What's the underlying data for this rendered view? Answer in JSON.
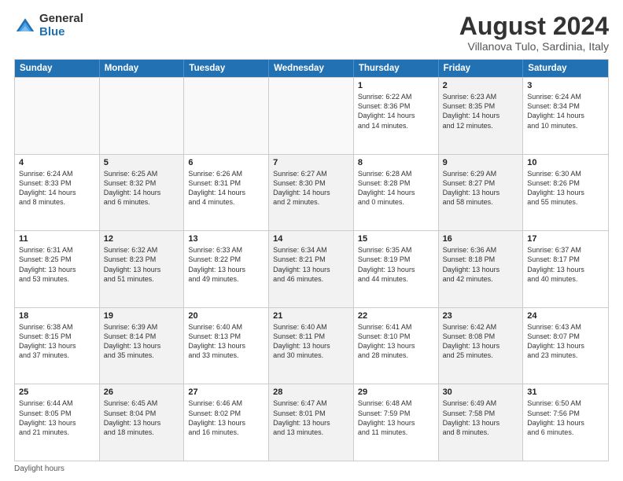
{
  "header": {
    "logo_general": "General",
    "logo_blue": "Blue",
    "month_year": "August 2024",
    "location": "Villanova Tulo, Sardinia, Italy"
  },
  "days_of_week": [
    "Sunday",
    "Monday",
    "Tuesday",
    "Wednesday",
    "Thursday",
    "Friday",
    "Saturday"
  ],
  "footer_note": "Daylight hours",
  "weeks": [
    [
      {
        "day": "",
        "detail": "",
        "shaded": true
      },
      {
        "day": "",
        "detail": "",
        "shaded": true
      },
      {
        "day": "",
        "detail": "",
        "shaded": true
      },
      {
        "day": "",
        "detail": "",
        "shaded": true
      },
      {
        "day": "1",
        "detail": "Sunrise: 6:22 AM\nSunset: 8:36 PM\nDaylight: 14 hours\nand 14 minutes.",
        "shaded": false
      },
      {
        "day": "2",
        "detail": "Sunrise: 6:23 AM\nSunset: 8:35 PM\nDaylight: 14 hours\nand 12 minutes.",
        "shaded": true
      },
      {
        "day": "3",
        "detail": "Sunrise: 6:24 AM\nSunset: 8:34 PM\nDaylight: 14 hours\nand 10 minutes.",
        "shaded": false
      }
    ],
    [
      {
        "day": "4",
        "detail": "Sunrise: 6:24 AM\nSunset: 8:33 PM\nDaylight: 14 hours\nand 8 minutes.",
        "shaded": false
      },
      {
        "day": "5",
        "detail": "Sunrise: 6:25 AM\nSunset: 8:32 PM\nDaylight: 14 hours\nand 6 minutes.",
        "shaded": true
      },
      {
        "day": "6",
        "detail": "Sunrise: 6:26 AM\nSunset: 8:31 PM\nDaylight: 14 hours\nand 4 minutes.",
        "shaded": false
      },
      {
        "day": "7",
        "detail": "Sunrise: 6:27 AM\nSunset: 8:30 PM\nDaylight: 14 hours\nand 2 minutes.",
        "shaded": true
      },
      {
        "day": "8",
        "detail": "Sunrise: 6:28 AM\nSunset: 8:28 PM\nDaylight: 14 hours\nand 0 minutes.",
        "shaded": false
      },
      {
        "day": "9",
        "detail": "Sunrise: 6:29 AM\nSunset: 8:27 PM\nDaylight: 13 hours\nand 58 minutes.",
        "shaded": true
      },
      {
        "day": "10",
        "detail": "Sunrise: 6:30 AM\nSunset: 8:26 PM\nDaylight: 13 hours\nand 55 minutes.",
        "shaded": false
      }
    ],
    [
      {
        "day": "11",
        "detail": "Sunrise: 6:31 AM\nSunset: 8:25 PM\nDaylight: 13 hours\nand 53 minutes.",
        "shaded": false
      },
      {
        "day": "12",
        "detail": "Sunrise: 6:32 AM\nSunset: 8:23 PM\nDaylight: 13 hours\nand 51 minutes.",
        "shaded": true
      },
      {
        "day": "13",
        "detail": "Sunrise: 6:33 AM\nSunset: 8:22 PM\nDaylight: 13 hours\nand 49 minutes.",
        "shaded": false
      },
      {
        "day": "14",
        "detail": "Sunrise: 6:34 AM\nSunset: 8:21 PM\nDaylight: 13 hours\nand 46 minutes.",
        "shaded": true
      },
      {
        "day": "15",
        "detail": "Sunrise: 6:35 AM\nSunset: 8:19 PM\nDaylight: 13 hours\nand 44 minutes.",
        "shaded": false
      },
      {
        "day": "16",
        "detail": "Sunrise: 6:36 AM\nSunset: 8:18 PM\nDaylight: 13 hours\nand 42 minutes.",
        "shaded": true
      },
      {
        "day": "17",
        "detail": "Sunrise: 6:37 AM\nSunset: 8:17 PM\nDaylight: 13 hours\nand 40 minutes.",
        "shaded": false
      }
    ],
    [
      {
        "day": "18",
        "detail": "Sunrise: 6:38 AM\nSunset: 8:15 PM\nDaylight: 13 hours\nand 37 minutes.",
        "shaded": false
      },
      {
        "day": "19",
        "detail": "Sunrise: 6:39 AM\nSunset: 8:14 PM\nDaylight: 13 hours\nand 35 minutes.",
        "shaded": true
      },
      {
        "day": "20",
        "detail": "Sunrise: 6:40 AM\nSunset: 8:13 PM\nDaylight: 13 hours\nand 33 minutes.",
        "shaded": false
      },
      {
        "day": "21",
        "detail": "Sunrise: 6:40 AM\nSunset: 8:11 PM\nDaylight: 13 hours\nand 30 minutes.",
        "shaded": true
      },
      {
        "day": "22",
        "detail": "Sunrise: 6:41 AM\nSunset: 8:10 PM\nDaylight: 13 hours\nand 28 minutes.",
        "shaded": false
      },
      {
        "day": "23",
        "detail": "Sunrise: 6:42 AM\nSunset: 8:08 PM\nDaylight: 13 hours\nand 25 minutes.",
        "shaded": true
      },
      {
        "day": "24",
        "detail": "Sunrise: 6:43 AM\nSunset: 8:07 PM\nDaylight: 13 hours\nand 23 minutes.",
        "shaded": false
      }
    ],
    [
      {
        "day": "25",
        "detail": "Sunrise: 6:44 AM\nSunset: 8:05 PM\nDaylight: 13 hours\nand 21 minutes.",
        "shaded": false
      },
      {
        "day": "26",
        "detail": "Sunrise: 6:45 AM\nSunset: 8:04 PM\nDaylight: 13 hours\nand 18 minutes.",
        "shaded": true
      },
      {
        "day": "27",
        "detail": "Sunrise: 6:46 AM\nSunset: 8:02 PM\nDaylight: 13 hours\nand 16 minutes.",
        "shaded": false
      },
      {
        "day": "28",
        "detail": "Sunrise: 6:47 AM\nSunset: 8:01 PM\nDaylight: 13 hours\nand 13 minutes.",
        "shaded": true
      },
      {
        "day": "29",
        "detail": "Sunrise: 6:48 AM\nSunset: 7:59 PM\nDaylight: 13 hours\nand 11 minutes.",
        "shaded": false
      },
      {
        "day": "30",
        "detail": "Sunrise: 6:49 AM\nSunset: 7:58 PM\nDaylight: 13 hours\nand 8 minutes.",
        "shaded": true
      },
      {
        "day": "31",
        "detail": "Sunrise: 6:50 AM\nSunset: 7:56 PM\nDaylight: 13 hours\nand 6 minutes.",
        "shaded": false
      }
    ]
  ]
}
